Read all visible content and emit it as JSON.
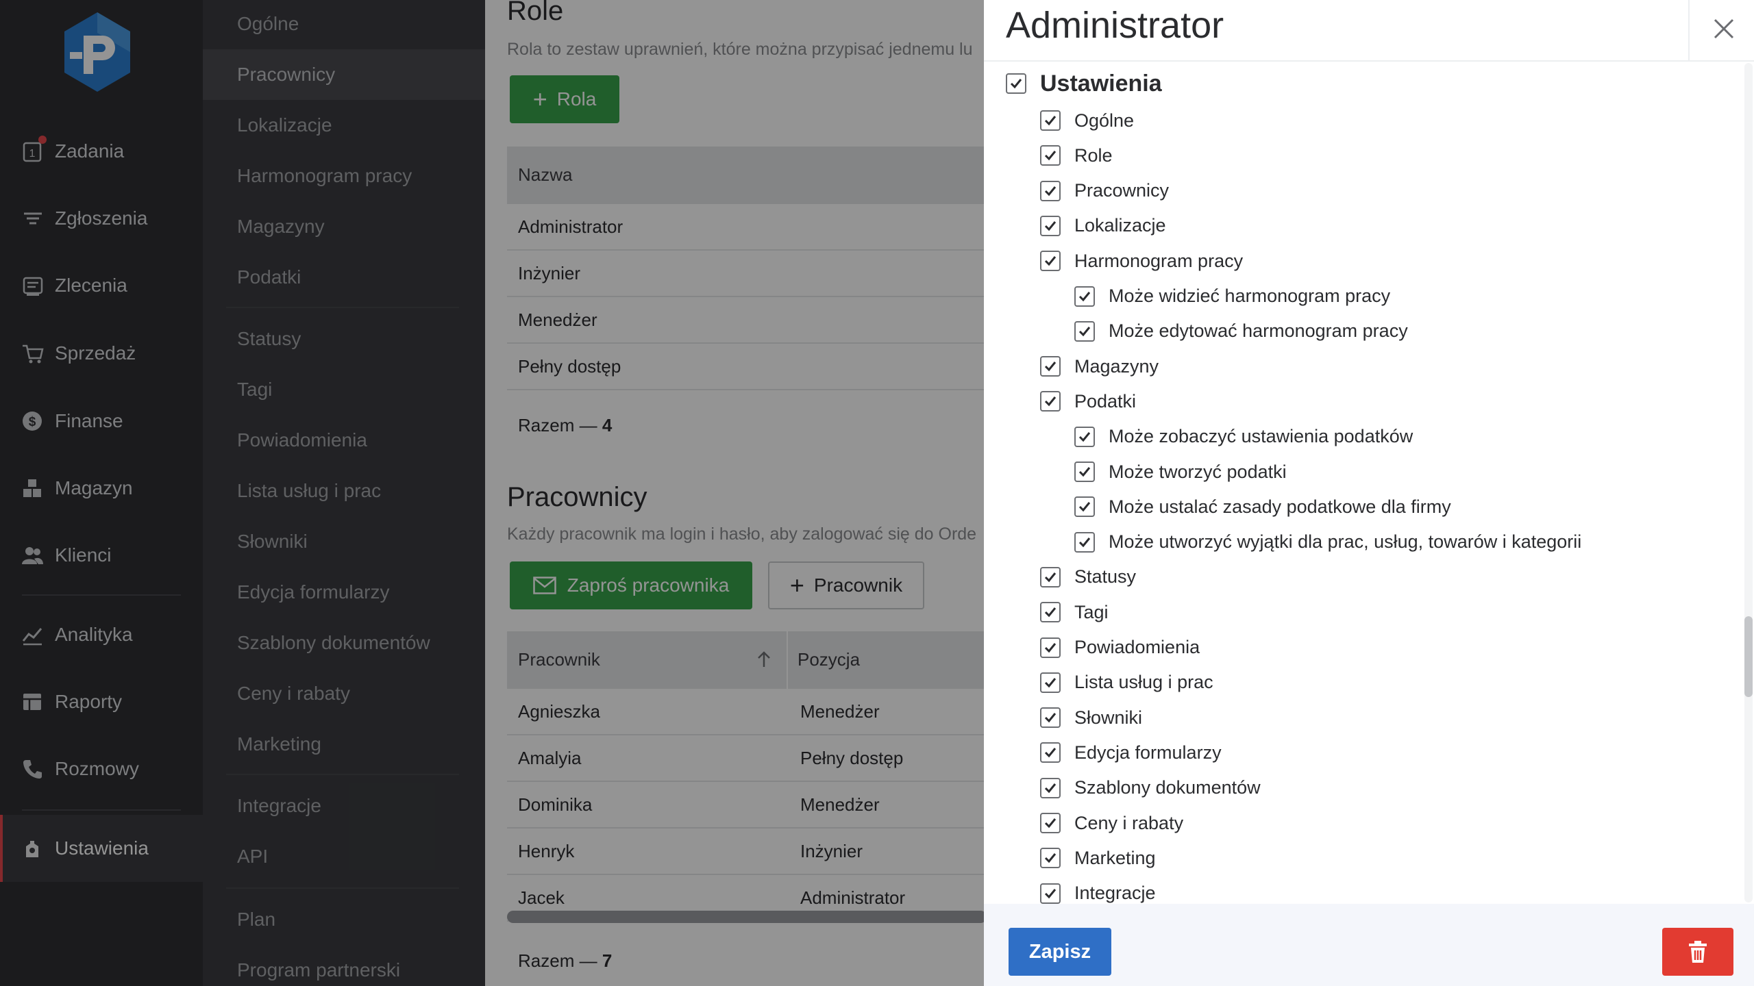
{
  "main_nav": {
    "items": [
      {
        "label": "Zadania",
        "icon": "tasks-icon"
      },
      {
        "label": "Zgłoszenia",
        "icon": "filter-icon"
      },
      {
        "label": "Zlecenia",
        "icon": "orders-icon"
      },
      {
        "label": "Sprzedaż",
        "icon": "cart-icon"
      },
      {
        "label": "Finanse",
        "icon": "dollar-icon"
      },
      {
        "label": "Magazyn",
        "icon": "boxes-icon"
      },
      {
        "label": "Klienci",
        "icon": "users-icon"
      },
      {
        "label": "Analityka",
        "icon": "chart-icon"
      },
      {
        "label": "Raporty",
        "icon": "table-icon"
      },
      {
        "label": "Rozmowy",
        "icon": "phone-icon"
      },
      {
        "label": "Ustawienia",
        "icon": "settings-icon"
      }
    ],
    "tasks_badge": "1",
    "active": "Ustawienia",
    "accent_color": "#e5484d"
  },
  "settings_nav": {
    "items": [
      "Ogólne",
      "Pracownicy",
      "Lokalizacje",
      "Harmonogram pracy",
      "Magazyny",
      "Podatki",
      "Statusy",
      "Tagi",
      "Powiadomienia",
      "Lista usług i prac",
      "Słowniki",
      "Edycja formularzy",
      "Szablony dokumentów",
      "Ceny i rabaty",
      "Marketing",
      "Integracje",
      "API",
      "Plan",
      "Program partnerski"
    ],
    "active": "Pracownicy"
  },
  "roles_section": {
    "title": "Role",
    "subtitle": "Rola to zestaw uprawnień, które można przypisać jednemu lu",
    "add_button": "Rola",
    "column_name": "Nazwa",
    "rows": [
      "Administrator",
      "Inżynier",
      "Menedżer",
      "Pełny dostęp"
    ],
    "total_label": "Razem —",
    "total_value": "4"
  },
  "employees_section": {
    "title": "Pracownicy",
    "subtitle": "Każdy pracownik ma login i hasło, aby zalogować się do Orde",
    "invite_button": "Zaproś pracownika",
    "add_button": "Pracownik",
    "columns": [
      "Pracownik",
      "Pozycja"
    ],
    "rows": [
      {
        "name": "Agnieszka",
        "position": "Menedżer"
      },
      {
        "name": "Amalyia",
        "position": "Pełny dostęp"
      },
      {
        "name": "Dominika",
        "position": "Menedżer"
      },
      {
        "name": "Henryk",
        "position": "Inżynier"
      },
      {
        "name": "Jacek",
        "position": "Administrator"
      }
    ],
    "total_label": "Razem —",
    "total_value": "7"
  },
  "drawer": {
    "title": "Administrator",
    "permissions": [
      {
        "label": "Ustawienia",
        "level": 0,
        "checked": true
      },
      {
        "label": "Ogólne",
        "level": 1,
        "checked": true
      },
      {
        "label": "Role",
        "level": 1,
        "checked": true
      },
      {
        "label": "Pracownicy",
        "level": 1,
        "checked": true
      },
      {
        "label": "Lokalizacje",
        "level": 1,
        "checked": true
      },
      {
        "label": "Harmonogram pracy",
        "level": 1,
        "checked": true
      },
      {
        "label": "Może widzieć harmonogram pracy",
        "level": 2,
        "checked": true
      },
      {
        "label": "Może edytować harmonogram pracy",
        "level": 2,
        "checked": true
      },
      {
        "label": "Magazyny",
        "level": 1,
        "checked": true
      },
      {
        "label": "Podatki",
        "level": 1,
        "checked": true
      },
      {
        "label": "Może zobaczyć ustawienia podatków",
        "level": 2,
        "checked": true
      },
      {
        "label": "Może tworzyć podatki",
        "level": 2,
        "checked": true
      },
      {
        "label": "Może ustalać zasady podatkowe dla firmy",
        "level": 2,
        "checked": true
      },
      {
        "label": "Może utworzyć wyjątki dla prac, usług, towarów i kategorii",
        "level": 2,
        "checked": true
      },
      {
        "label": "Statusy",
        "level": 1,
        "checked": true
      },
      {
        "label": "Tagi",
        "level": 1,
        "checked": true
      },
      {
        "label": "Powiadomienia",
        "level": 1,
        "checked": true
      },
      {
        "label": "Lista usług i prac",
        "level": 1,
        "checked": true
      },
      {
        "label": "Słowniki",
        "level": 1,
        "checked": true
      },
      {
        "label": "Edycja formularzy",
        "level": 1,
        "checked": true
      },
      {
        "label": "Szablony dokumentów",
        "level": 1,
        "checked": true
      },
      {
        "label": "Ceny i rabaty",
        "level": 1,
        "checked": true
      },
      {
        "label": "Marketing",
        "level": 1,
        "checked": true
      },
      {
        "label": "Integracje",
        "level": 1,
        "checked": true
      }
    ],
    "save_button": "Zapisz",
    "save_color": "#2f6fc6",
    "delete_color": "#e23b31"
  }
}
